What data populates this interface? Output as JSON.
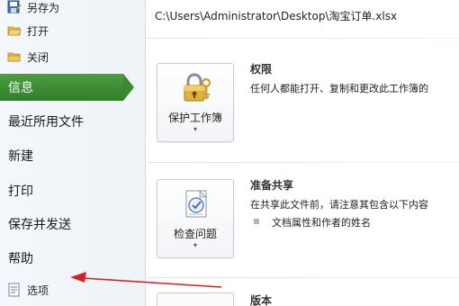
{
  "sidebar": {
    "small_items": [
      {
        "label": "另存为",
        "icon": "save-as-icon"
      },
      {
        "label": "打开",
        "icon": "open-folder-icon"
      },
      {
        "label": "关闭",
        "icon": "close-folder-icon"
      }
    ],
    "selected": "信息",
    "items": [
      "最近所用文件",
      "新建",
      "打印",
      "保存并发送",
      "帮助"
    ],
    "options_label": "选项",
    "accent_color": "#3a8a33"
  },
  "main": {
    "file_path": "C:\\Users\\Administrator\\Desktop\\淘宝订单.xlsx",
    "sections": [
      {
        "button_label": "保护工作簿",
        "button_icon": "lock-keys-icon",
        "title": "权限",
        "description": "任何人都能打开、复制和更改此工作簿的"
      },
      {
        "button_label": "检查问题",
        "button_icon": "checklist-icon",
        "title": "准备共享",
        "description": "在共享此文件前，请注意其包含以下内容",
        "sub_items": [
          "文档属性和作者的姓名"
        ]
      },
      {
        "title": "版本"
      }
    ]
  },
  "annotation": {
    "arrow_color": "#d9202a"
  }
}
